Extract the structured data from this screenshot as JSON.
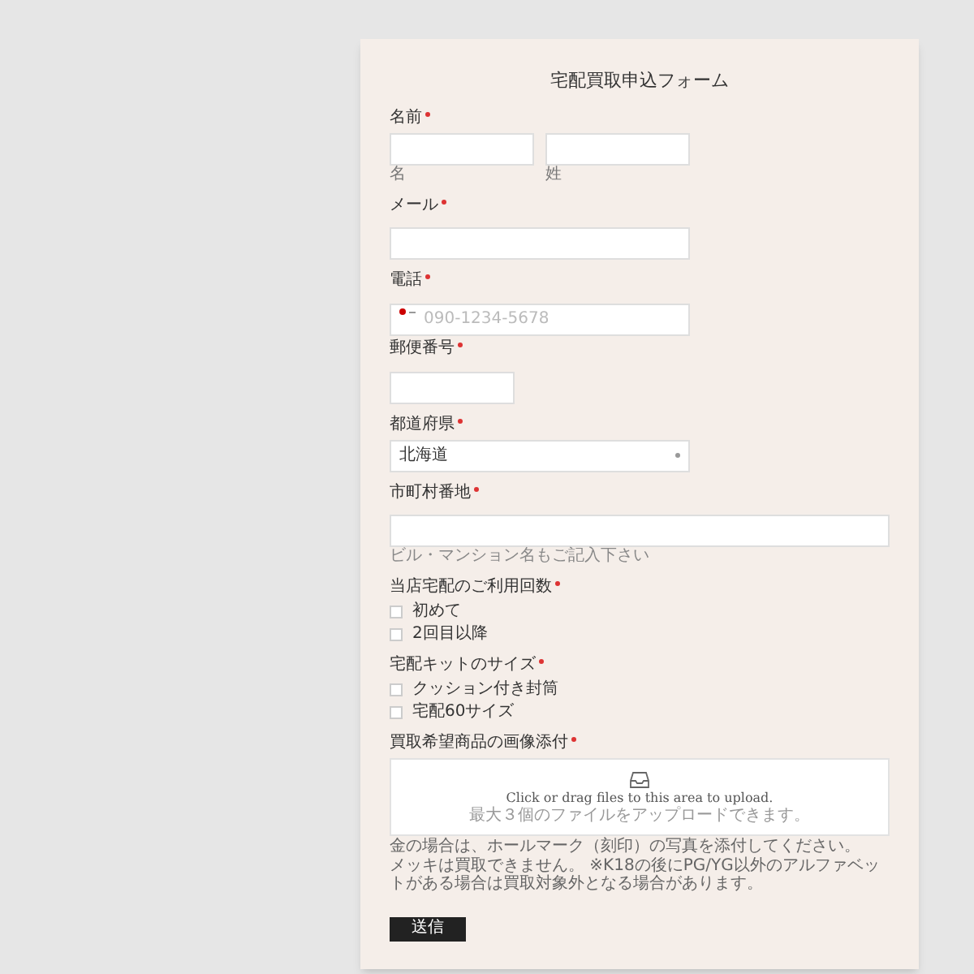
{
  "form": {
    "title": "宅配買取申込フォーム",
    "fields": [
      {
        "kind": "name",
        "label": "名前",
        "required": true,
        "sublabels": [
          "名",
          "姓"
        ]
      },
      {
        "kind": "text",
        "label": "メール",
        "required": true
      },
      {
        "kind": "phone",
        "label": "電話",
        "required": true,
        "placeholder": "090-1234-5678"
      },
      {
        "kind": "short",
        "label": "郵便番号",
        "required": true
      },
      {
        "kind": "select",
        "label": "都道府県",
        "required": true,
        "value": "北海道"
      },
      {
        "kind": "text",
        "label": "市町村番地",
        "required": true,
        "help": "ビル・マンション名もご記入下さい"
      },
      {
        "kind": "checkboxes",
        "label": "当店宅配のご利用回数",
        "required": true,
        "options": [
          {
            "label": "初めて",
            "checked": false
          },
          {
            "label": "2回目以降",
            "checked": false
          }
        ]
      },
      {
        "kind": "checkboxes",
        "label": "宅配キットのサイズ",
        "required": true,
        "options": [
          {
            "label": "クッション付き封筒",
            "checked": false
          },
          {
            "label": "宅配60サイズ",
            "checked": false
          }
        ]
      },
      {
        "kind": "upload",
        "label": "買取希望商品の画像添付",
        "required": true,
        "prompt": "Click or drag files to this area to upload.",
        "hint": "最大３個のファイルをアップロードできます。",
        "notes": [
          "金の場合は、ホールマーク（刻印）の写真を添付してください。",
          "メッキは買取できません。 ※K18の後にPG/YG以外のアルファベットがある場合は買取対象外となる場合があります。"
        ]
      }
    ],
    "submit": "送信"
  }
}
